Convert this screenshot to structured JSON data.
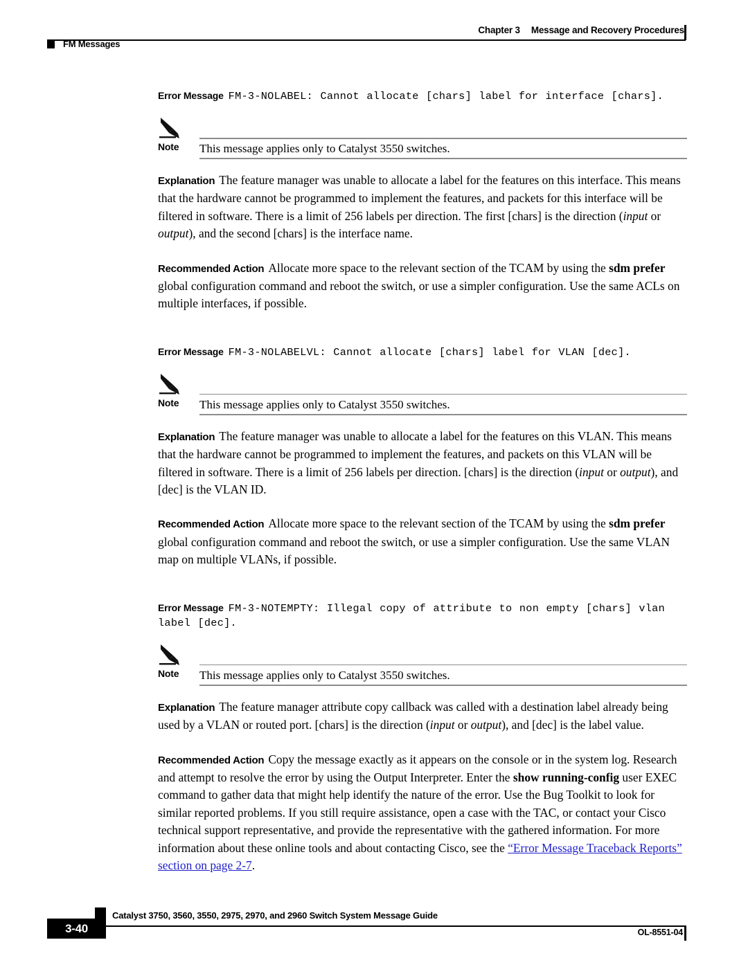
{
  "header": {
    "chapter": "Chapter 3",
    "chapter_title": "Message and Recovery Procedures",
    "section": "FM Messages"
  },
  "messages": [
    {
      "error_message_label": "Error Message",
      "error_message_text": "FM-3-NOLABEL: Cannot allocate [chars] label for interface [chars].",
      "note_label": "Note",
      "note_text": "This message applies only to Catalyst 3550 switches.",
      "explanation_label": "Explanation",
      "explanation_parts": {
        "p1": "The feature manager was unable to allocate a label for the features on this interface. This means that the hardware cannot be programmed to implement the features, and packets for this interface will be filtered in software. There is a limit of 256 labels per direction. The first [chars] is the direction (",
        "em1": "input",
        "p2": " or ",
        "em2": "output",
        "p3": "), and the second [chars] is the interface name."
      },
      "action_label": "Recommended Action",
      "action_parts": {
        "p1": "Allocate more space to the relevant section of the TCAM by using the ",
        "b1": "sdm prefer",
        "p2": " global configuration command and reboot the switch, or use a simpler configuration. Use the same ACLs on multiple interfaces, if possible."
      }
    },
    {
      "error_message_label": "Error Message",
      "error_message_text": "FM-3-NOLABELVL: Cannot allocate [chars] label for VLAN [dec].",
      "note_label": "Note",
      "note_text": "This message applies only to Catalyst 3550 switches.",
      "explanation_label": "Explanation",
      "explanation_parts": {
        "p1": "The feature manager was unable to allocate a label for the features on this VLAN. This means that the hardware cannot be programmed to implement the features, and packets on this VLAN will be filtered in software. There is a limit of 256 labels per direction. [chars] is the direction (",
        "em1": "input",
        "p2": " or ",
        "em2": "output",
        "p3": "), and [dec] is the VLAN ID."
      },
      "action_label": "Recommended Action",
      "action_parts": {
        "p1": "Allocate more space to the relevant section of the TCAM by using the ",
        "b1": "sdm prefer",
        "p2": " global configuration command and reboot the switch, or use a simpler configuration. Use the same VLAN map on multiple VLANs, if possible."
      }
    },
    {
      "error_message_label": "Error Message",
      "error_message_text": "FM-3-NOTEMPTY: Illegal copy of attribute to non empty [chars] vlan label [dec].",
      "note_label": "Note",
      "note_text": "This message applies only to Catalyst 3550 switches.",
      "explanation_label": "Explanation",
      "explanation_parts": {
        "p1": "The feature manager attribute copy callback was called with a destination label already being used by a VLAN or routed port. [chars] is the direction (",
        "em1": "input",
        "p2": " or ",
        "em2": "output",
        "p3": "), and [dec] is the label value."
      },
      "action_label": "Recommended Action",
      "action_parts": {
        "p1": "Copy the message exactly as it appears on the console or in the system log. Research and attempt to resolve the error by using the Output Interpreter. Enter the ",
        "b1": "show running-config",
        "p2": " user EXEC command to gather data that might help identify the nature of the error. Use the Bug Toolkit to look for similar reported problems. If you still require assistance, open a case with the TAC, or contact your Cisco technical support representative, and provide the representative with the gathered information. For more information about these online tools and about contacting Cisco, see the ",
        "link": "“Error Message Traceback Reports” section on page 2-7",
        "p3": "."
      }
    }
  ],
  "footer": {
    "guide_title": "Catalyst 3750, 3560, 3550, 2975, 2970, and 2960 Switch System Message Guide",
    "page_number": "3-40",
    "doc_id": "OL-8551-04"
  },
  "colors": {
    "link": "#2020cc",
    "rule": "#8c8c8c",
    "text": "#000000"
  }
}
